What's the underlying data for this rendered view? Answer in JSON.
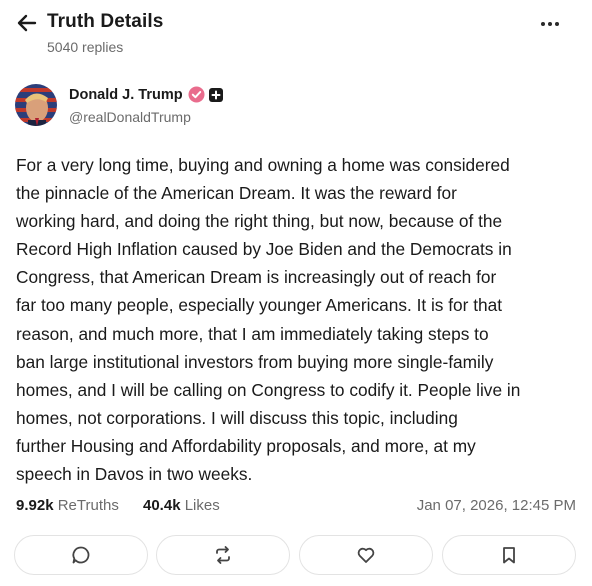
{
  "header": {
    "title": "Truth Details",
    "subtitle": "5040 replies"
  },
  "author": {
    "name": "Donald J. Trump",
    "handle": "@realDonaldTrump"
  },
  "post": {
    "text": "For a very long time, buying and owning a home was considered\nthe pinnacle of the American Dream. It was the reward for\nworking hard, and doing the right thing, but now, because of the\nRecord High Inflation caused by Joe Biden and the Democrats in\nCongress, that American Dream is increasingly out of reach for\nfar too many people, especially younger Americans. It is for that\nreason, and much more, that I am immediately taking steps to\nban large institutional investors from buying more single-family\nhomes, and I will be calling on Congress to codify it. People live in\nhomes, not corporations. I will discuss this topic, including\nfurther Housing and Affordability proposals, and more, at my\nspeech in Davos in two weeks."
  },
  "stats": {
    "retruths_count": "9.92k",
    "retruths_label": "ReTruths",
    "likes_count": "40.4k",
    "likes_label": "Likes",
    "timestamp": "Jan 07, 2026, 12:45 PM"
  },
  "actions": [
    {
      "icon": "reply-icon"
    },
    {
      "icon": "retruth-icon"
    },
    {
      "icon": "heart-icon"
    },
    {
      "icon": "bookmark-icon"
    }
  ],
  "colors": {
    "text": "#1a1a1a",
    "muted": "#6b6b6b",
    "verified": "#e96c8d",
    "border": "#e3e3e3"
  }
}
